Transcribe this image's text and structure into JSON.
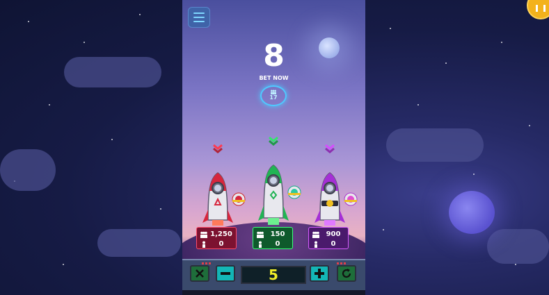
{
  "game": {
    "countdown": "8",
    "bet_now_label": "BET NOW",
    "players_count": "17"
  },
  "rockets": [
    {
      "name": "red",
      "color": "#ff3a4f",
      "total_bets": "1,250",
      "my_bet": "0"
    },
    {
      "name": "green",
      "color": "#31e86a",
      "total_bets": "150",
      "my_bet": "0"
    },
    {
      "name": "purple",
      "color": "#d64cff",
      "total_bets": "900",
      "my_bet": "0"
    }
  ],
  "controls": {
    "bet_amount": "5"
  },
  "icons": {
    "menu": "hamburger-menu-icon",
    "coins": "coin-icon",
    "clear": "x-icon",
    "minus": "minus-icon",
    "plus": "plus-icon",
    "repeat": "refresh-icon",
    "players": "players-icon",
    "person": "person-icon"
  },
  "colors": {
    "accent_cyan": "#13b6b6",
    "display_yellow": "#f2ee29",
    "coin_gold": "#f3b21c"
  }
}
